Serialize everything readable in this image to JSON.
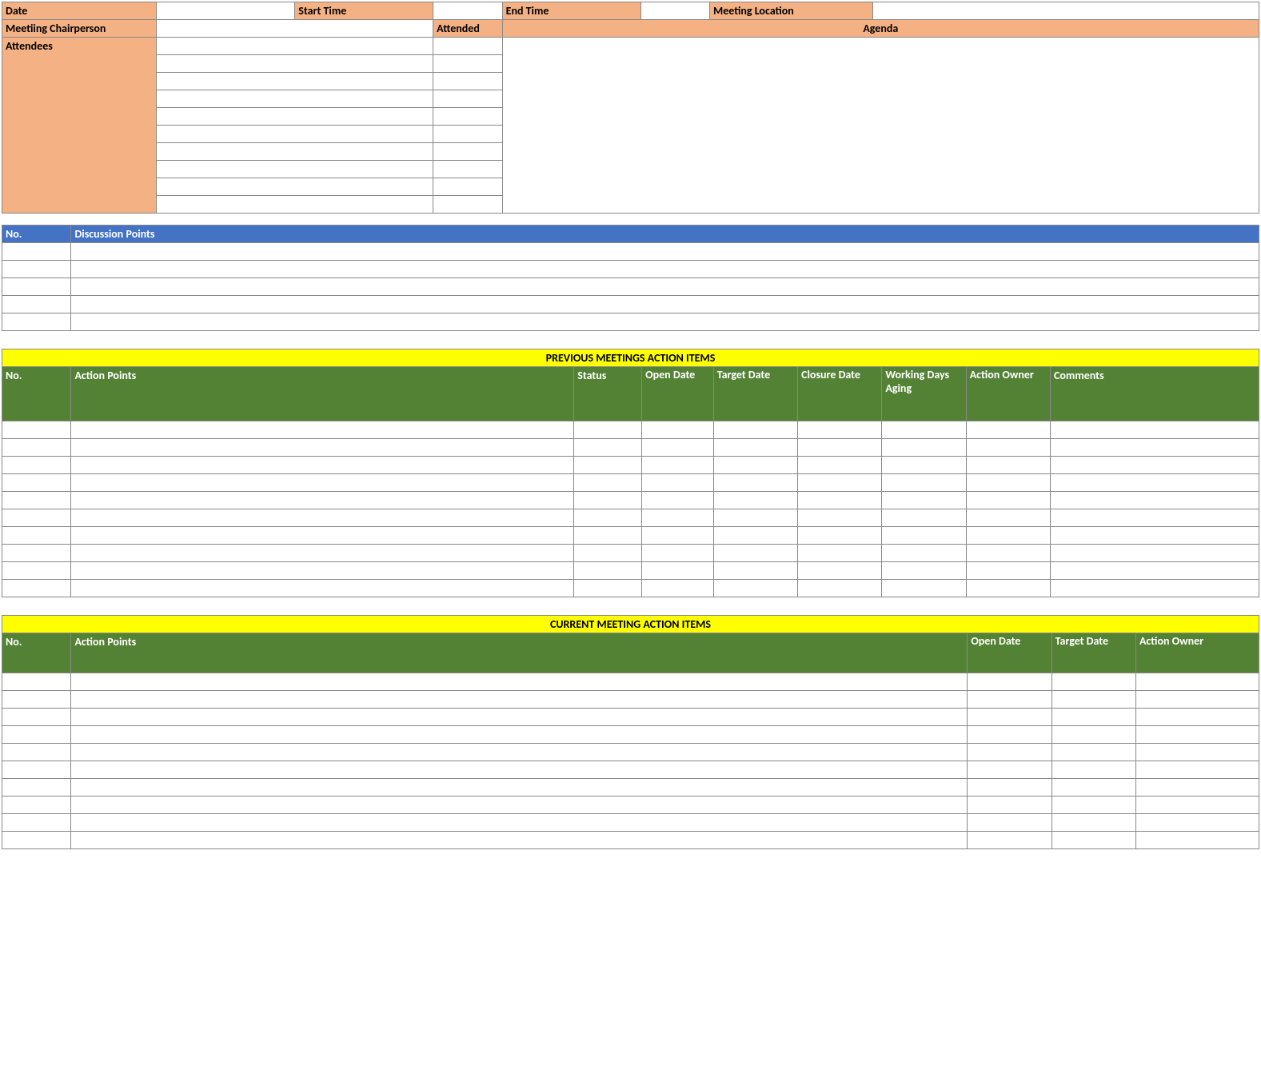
{
  "header": {
    "date_label": "Date",
    "start_time_label": "Start Time",
    "end_time_label": "End Time",
    "meeting_location_label": "Meeting Location",
    "chairperson_label": "Meetiing Chairperson",
    "attended_label": "Attended",
    "agenda_label": "Agenda",
    "attendees_label": "Attendees"
  },
  "discussion": {
    "no_label": "No.",
    "points_label": "Discussion Points"
  },
  "previous": {
    "title": "PREVIOUS MEETINGS ACTION ITEMS",
    "cols": {
      "no": "No.",
      "action_points": "Action Points",
      "status": "Status",
      "open_date": "Open Date",
      "target_date": "Target Date",
      "closure_date": "Closure Date",
      "working_aging": "Working Days Aging",
      "action_owner": "Action Owner",
      "comments": "Comments"
    }
  },
  "current": {
    "title": "CURRENT MEETING ACTION ITEMS",
    "cols": {
      "no": "No.",
      "action_points": "Action Points",
      "open_date": "Open Date",
      "target_date": "Target Date",
      "action_owner": "Action Owner"
    }
  }
}
